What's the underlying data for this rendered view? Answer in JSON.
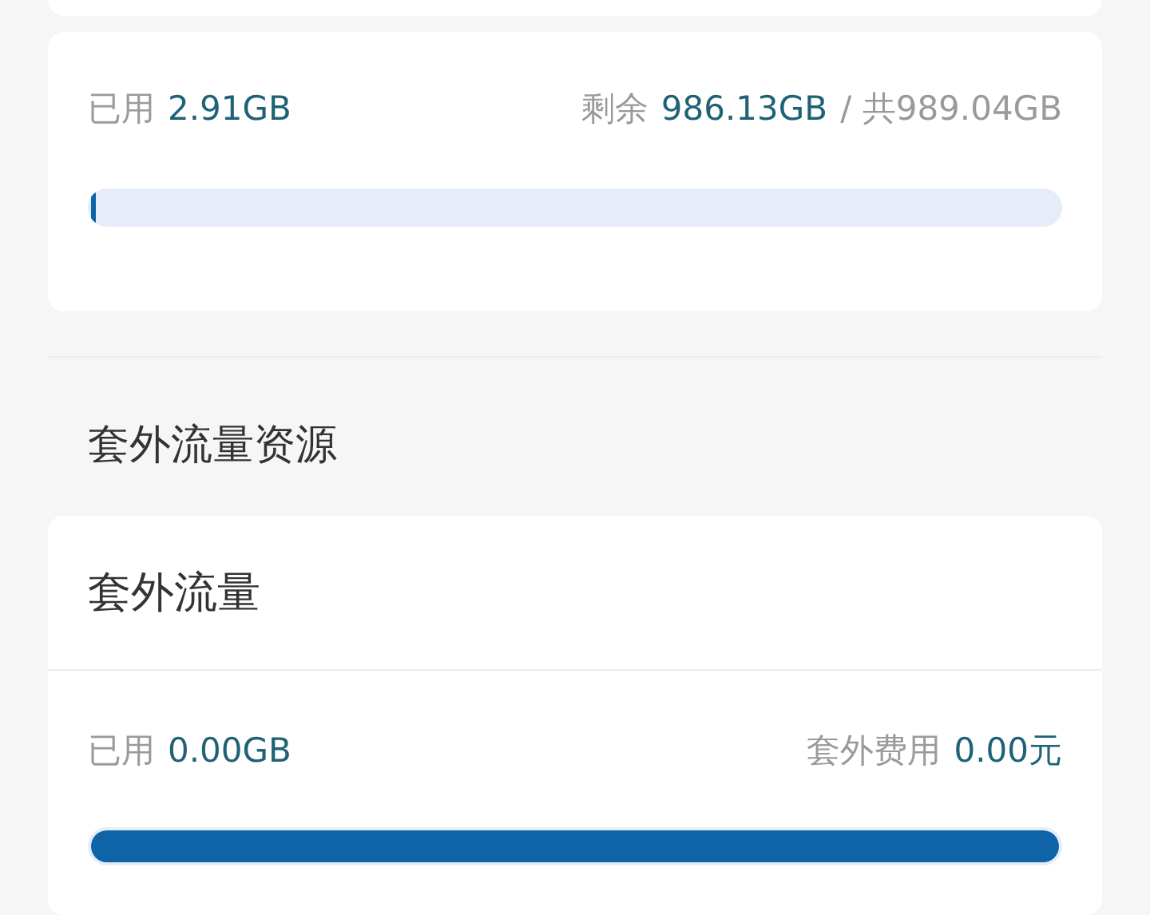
{
  "quota_card": {
    "used_label": "已用",
    "used_value": "2.91GB",
    "remaining_label": "剩余",
    "remaining_value": "986.13GB",
    "total": "/ 共989.04GB",
    "level": 0.004
  },
  "section_title": "套外流量资源",
  "overage_card": {
    "title": "套外流量",
    "used_label": "已用",
    "used_value": "0.00GB",
    "fee_label": "套外费用",
    "fee_value": "0.00元",
    "level": 1
  }
}
